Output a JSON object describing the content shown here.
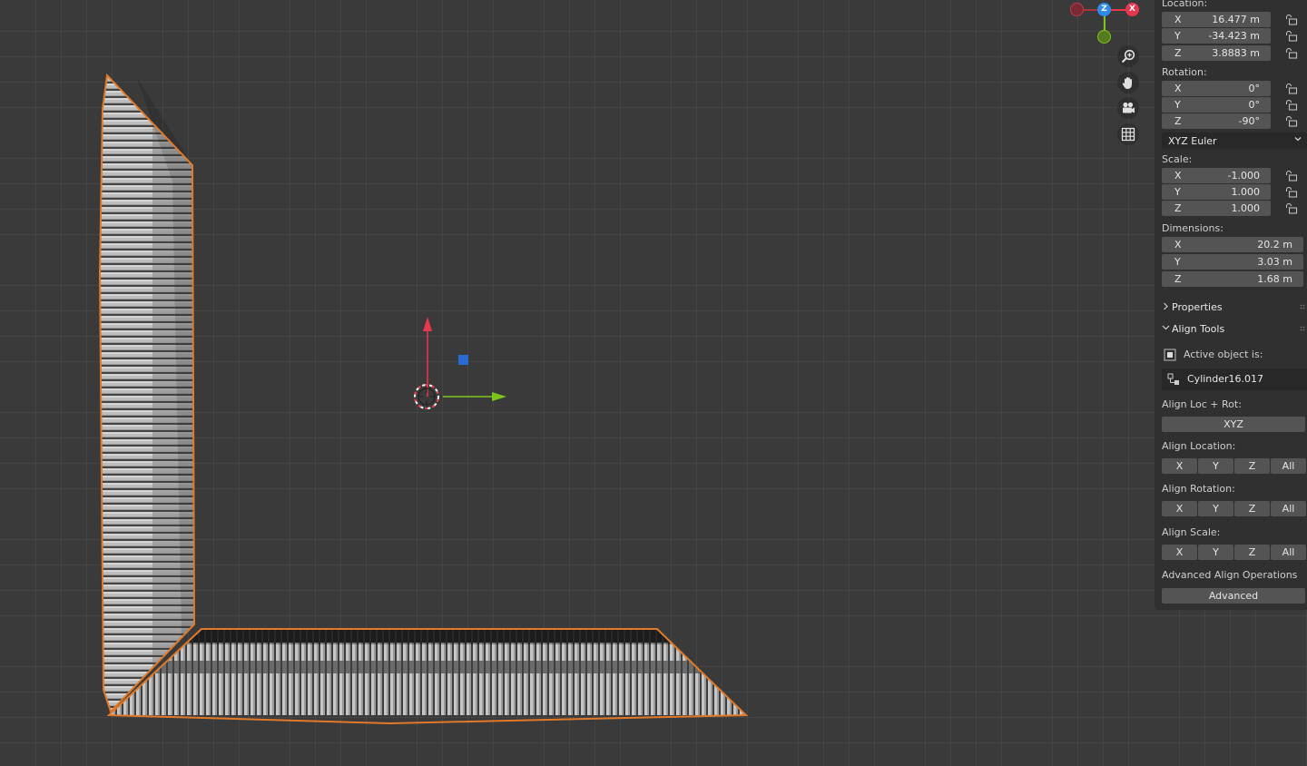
{
  "panel": {
    "location": {
      "label": "Location:",
      "fields": [
        {
          "axis": "X",
          "value": "16.477 m"
        },
        {
          "axis": "Y",
          "value": "-34.423 m"
        },
        {
          "axis": "Z",
          "value": "3.8883 m"
        }
      ]
    },
    "rotation": {
      "label": "Rotation:",
      "fields": [
        {
          "axis": "X",
          "value": "0°"
        },
        {
          "axis": "Y",
          "value": "0°"
        },
        {
          "axis": "Z",
          "value": "-90°"
        }
      ],
      "mode": "XYZ Euler"
    },
    "scale": {
      "label": "Scale:",
      "fields": [
        {
          "axis": "X",
          "value": "-1.000"
        },
        {
          "axis": "Y",
          "value": "1.000"
        },
        {
          "axis": "Z",
          "value": "1.000"
        }
      ]
    },
    "dimensions": {
      "label": "Dimensions:",
      "fields": [
        {
          "axis": "X",
          "value": "20.2 m"
        },
        {
          "axis": "Y",
          "value": "3.03 m"
        },
        {
          "axis": "Z",
          "value": "1.68 m"
        }
      ]
    },
    "properties": {
      "label": "Properties"
    },
    "align_tools": {
      "label": "Align Tools",
      "active_object_label": "Active object is:",
      "active_object": "Cylinder16.017",
      "loc_rot_label": "Align Loc + Rot:",
      "loc_rot_button": "XYZ",
      "location_label": "Align Location:",
      "rotation_label": "Align Rotation:",
      "scale_label": "Align Scale:",
      "axis_buttons": [
        "X",
        "Y",
        "Z",
        "All"
      ],
      "advanced_label": "Advanced Align Operations",
      "advanced_button": "Advanced"
    }
  },
  "gizmo": {
    "x": "X",
    "z": "Z"
  },
  "colors": {
    "axis_x": "#e8384f",
    "axis_y": "#7ec41d",
    "axis_z": "#2d8ceb",
    "selection_outline": "#e07a2a",
    "viewport_bg": "#3a3a3a",
    "panel_bg": "#303030"
  },
  "nav_icons": [
    "zoom-icon",
    "hand-pan-icon",
    "camera-icon",
    "grid-icon"
  ]
}
